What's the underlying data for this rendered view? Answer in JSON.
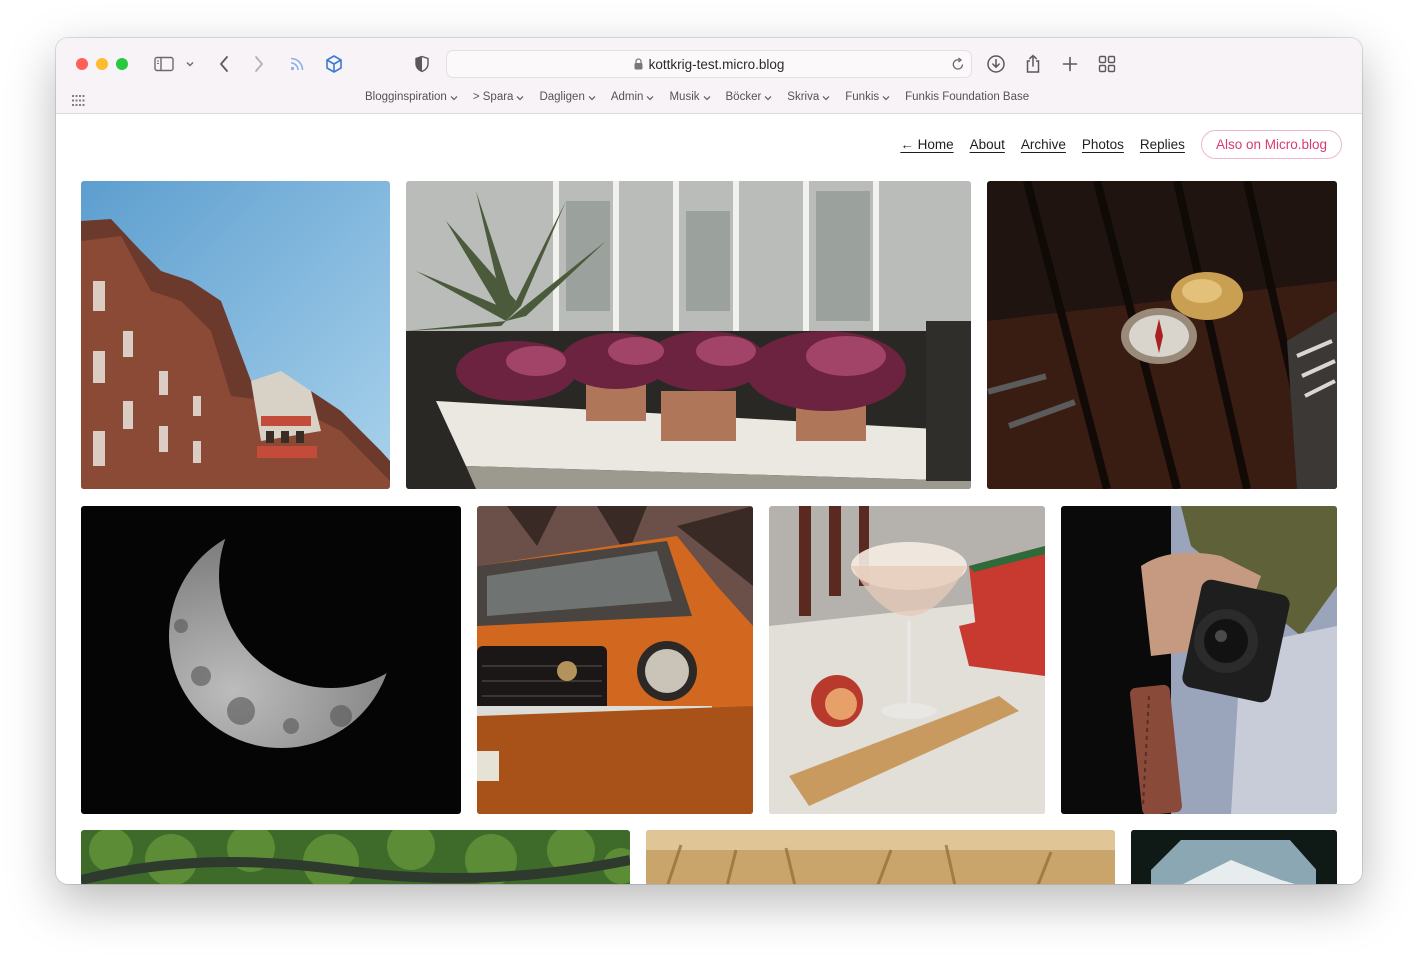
{
  "browser": {
    "url": "kottkrig-test.micro.blog",
    "bookmarks": [
      {
        "label": "Blogginspiration",
        "chevron": true
      },
      {
        "label": "> Spara",
        "chevron": true
      },
      {
        "label": "Dagligen",
        "chevron": true
      },
      {
        "label": "Admin",
        "chevron": true
      },
      {
        "label": "Musik",
        "chevron": true
      },
      {
        "label": "Böcker",
        "chevron": true
      },
      {
        "label": "Skriva",
        "chevron": true
      },
      {
        "label": "Funkis",
        "chevron": true
      },
      {
        "label": "Funkis Foundation Base",
        "chevron": false
      }
    ]
  },
  "nav": {
    "home": "← Home",
    "about": "About",
    "archive": "Archive",
    "photos": "Photos",
    "replies": "Replies",
    "also_on": "Also on Micro.blog"
  },
  "colors": {
    "accent": "#d63b78",
    "accent_border": "#f0b7cc"
  },
  "gallery": [
    {
      "name": "photo-london-buildings"
    },
    {
      "name": "photo-greenhouse-plants"
    },
    {
      "name": "photo-compass-on-table"
    },
    {
      "name": "photo-crescent-moon"
    },
    {
      "name": "photo-orange-car"
    },
    {
      "name": "photo-cocktail-watermelon"
    },
    {
      "name": "photo-hand-camera"
    },
    {
      "name": "photo-forest-aerial"
    },
    {
      "name": "photo-wheat-field"
    },
    {
      "name": "photo-mountain-trees"
    }
  ]
}
